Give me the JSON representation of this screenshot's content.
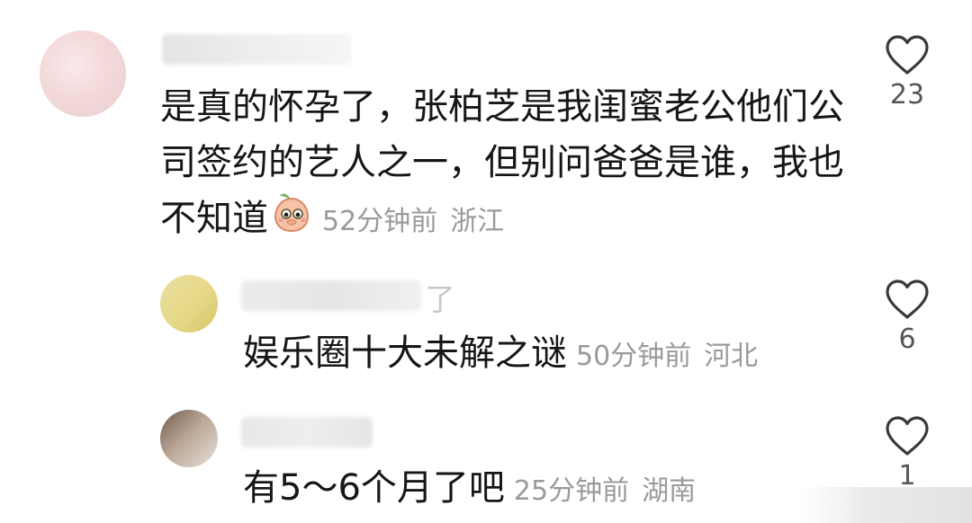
{
  "comments": [
    {
      "text_lines": [
        "是真的怀孕了，张柏芝是我闺蜜老公他们公",
        "司签约的艺人之一，但别问爸爸是谁，我也",
        "不知道"
      ],
      "emoji": "peach-covering-mouth-emoji",
      "time": "52分钟前",
      "location": "浙江",
      "likes": "23"
    },
    {
      "username_visible": "了",
      "text": "娱乐圈十大未解之谜",
      "time": "50分钟前",
      "location": "河北",
      "likes": "6"
    },
    {
      "text": "有5～6个月了吧",
      "time": "25分钟前",
      "location": "湖南",
      "likes": "1"
    }
  ],
  "icons": {
    "like": "heart-outline-icon"
  },
  "colors": {
    "text": "#161616",
    "meta": "#9a9a9a",
    "count": "#555555"
  }
}
